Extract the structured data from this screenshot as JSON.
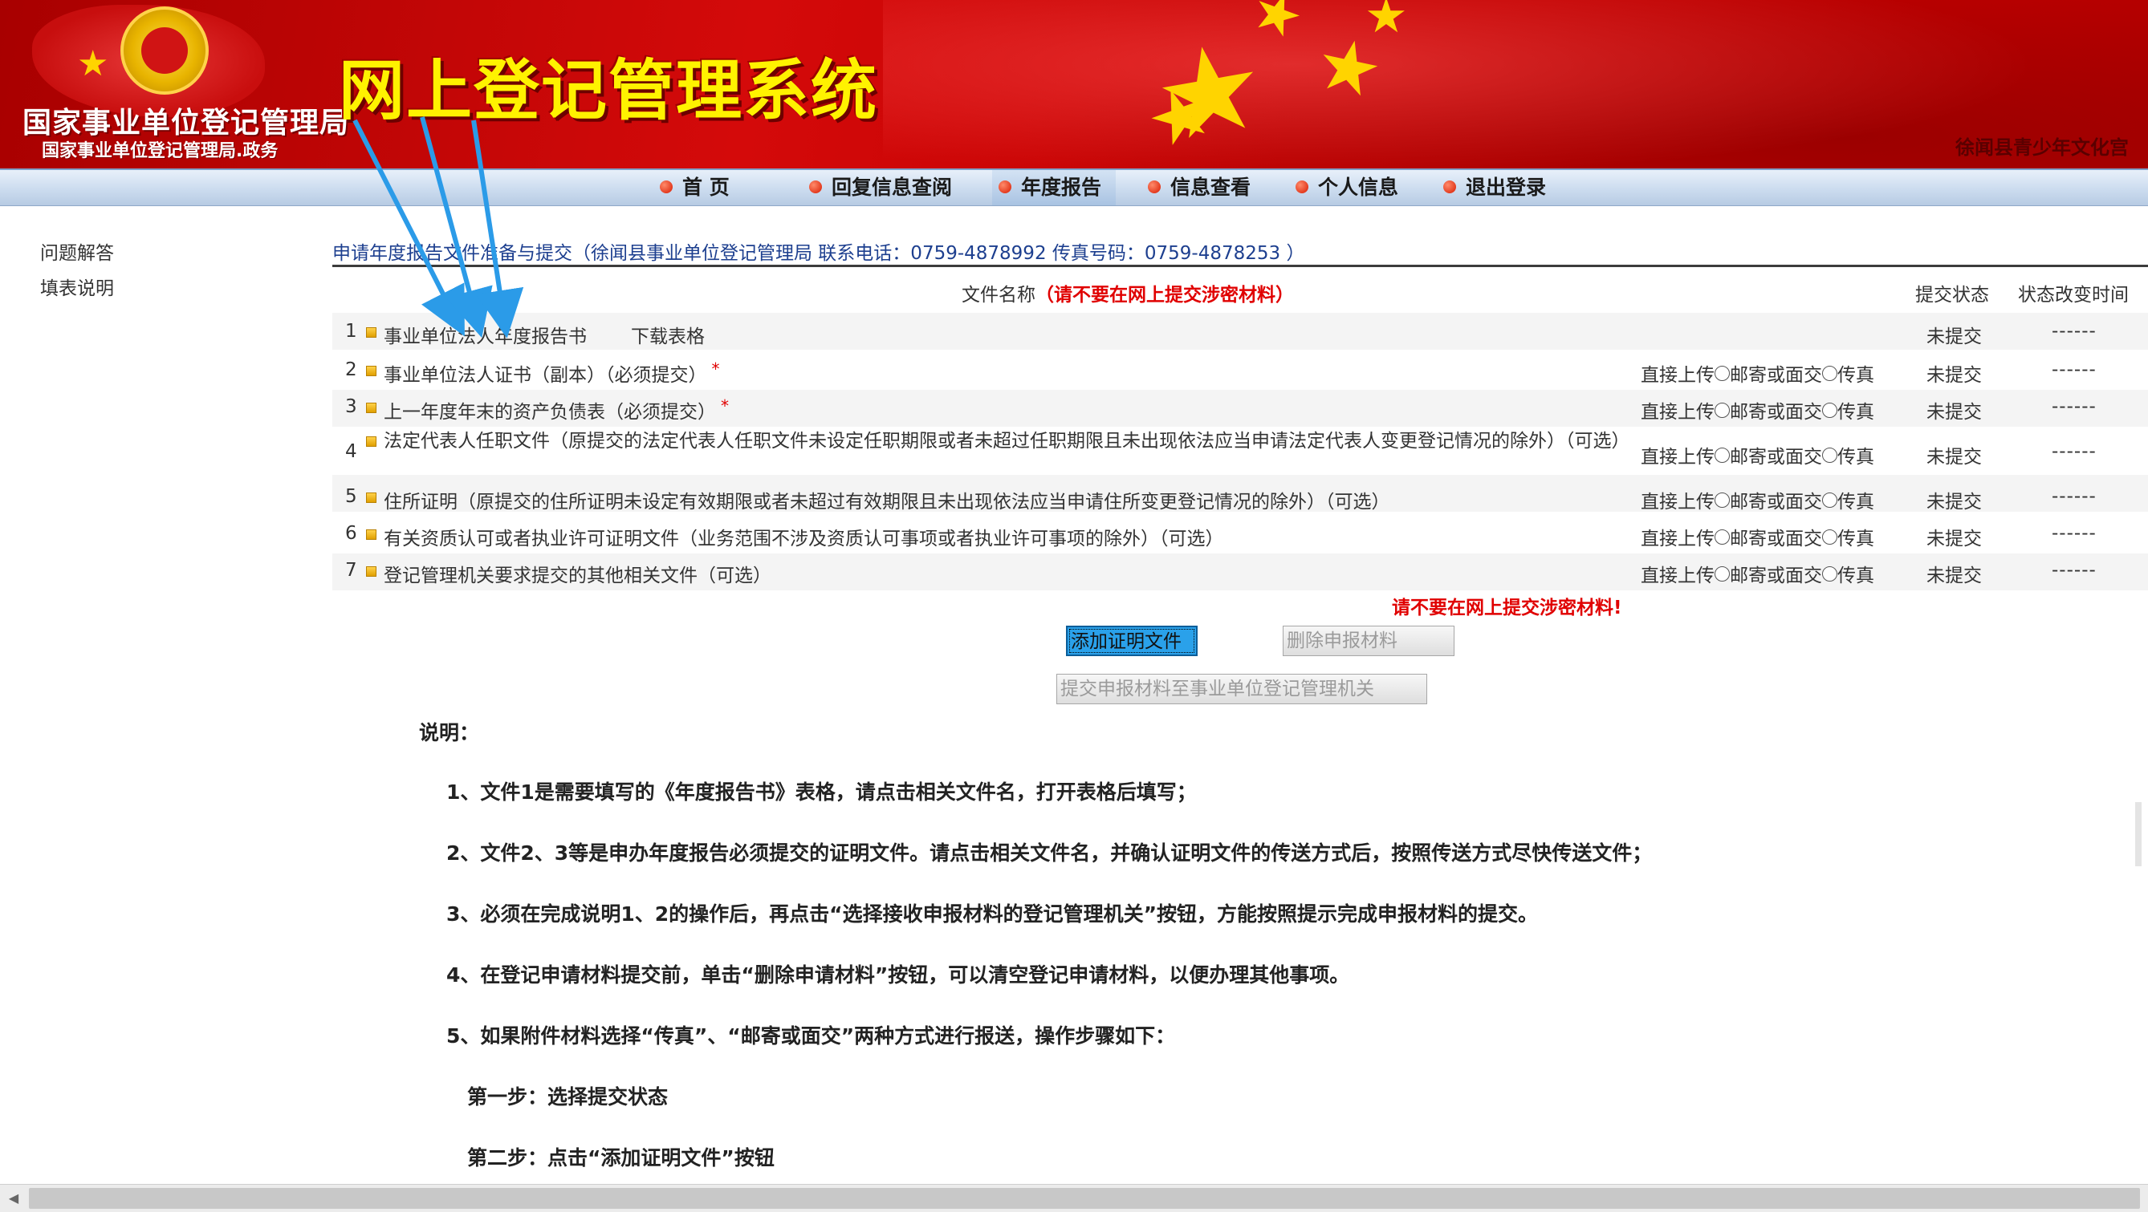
{
  "banner": {
    "org_name": "国家事业单位登记管理局",
    "org_subtitle": "国家事业单位登记管理局.政务",
    "system_title": "网上登记管理系统",
    "unit_name": "徐闻县青少年文化宫"
  },
  "nav": {
    "items": [
      {
        "label": "首  页"
      },
      {
        "label": "回复信息查阅"
      },
      {
        "label": "年度报告"
      },
      {
        "label": "信息查看"
      },
      {
        "label": "个人信息"
      },
      {
        "label": "退出登录"
      }
    ],
    "active": "年度报告"
  },
  "sidebar": {
    "items": [
      {
        "label": "问题解答"
      },
      {
        "label": "填表说明"
      }
    ]
  },
  "main": {
    "header": "申请年度报告文件准备与提交（徐闻县事业单位登记管理局 联系电话：0759-4878992 传真号码：0759-4878253 ）",
    "columns": {
      "file_name": "文件名称",
      "file_name_warning": "（请不要在网上提交涉密材料）",
      "status": "提交状态",
      "change_time": "状态改变时间"
    },
    "rows": [
      {
        "num": "1",
        "name": "事业单位法人年度报告书",
        "download": "下载表格",
        "status": "未提交",
        "time": "------"
      },
      {
        "num": "2",
        "name": "事业单位法人证书（副本）（必须提交）",
        "required_mark": "*",
        "opt_upload": "直接上传",
        "opt_mail": "邮寄或面交",
        "opt_fax": "传真",
        "status": "未提交",
        "time": "------"
      },
      {
        "num": "3",
        "name": "上一年度年末的资产负债表（必须提交）",
        "required_mark": "*",
        "opt_upload": "直接上传",
        "opt_mail": "邮寄或面交",
        "opt_fax": "传真",
        "status": "未提交",
        "time": "------"
      },
      {
        "num": "4",
        "name": "法定代表人任职文件（原提交的法定代表人任职文件未设定任职期限或者未超过任职期限且未出现依法应当申请法定代表人变更登记情况的除外）（可选）",
        "opt_upload": "直接上传",
        "opt_mail": "邮寄或面交",
        "opt_fax": "传真",
        "status": "未提交",
        "time": "------"
      },
      {
        "num": "5",
        "name": "住所证明（原提交的住所证明未设定有效期限或者未超过有效期限且未出现依法应当申请住所变更登记情况的除外）（可选）",
        "opt_upload": "直接上传",
        "opt_mail": "邮寄或面交",
        "opt_fax": "传真",
        "status": "未提交",
        "time": "------"
      },
      {
        "num": "6",
        "name": "有关资质认可或者执业许可证明文件（业务范围不涉及资质认可事项或者执业许可事项的除外）（可选）",
        "opt_upload": "直接上传",
        "opt_mail": "邮寄或面交",
        "opt_fax": "传真",
        "status": "未提交",
        "time": "------"
      },
      {
        "num": "7",
        "name": "登记管理机关要求提交的其他相关文件（可选）",
        "opt_upload": "直接上传",
        "opt_mail": "邮寄或面交",
        "opt_fax": "传真",
        "status": "未提交",
        "time": "------"
      }
    ],
    "warning": "请不要在网上提交涉密材料!",
    "buttons": {
      "add": "添加证明文件",
      "delete": "删除申报材料",
      "submit": "提交申报材料至事业单位登记管理机关"
    }
  },
  "instructions": {
    "title": "说明：",
    "items": [
      "1、文件1是需要填写的《年度报告书》表格，请点击相关文件名，打开表格后填写；",
      "2、文件2、3等是申办年度报告必须提交的证明文件。请点击相关文件名，并确认证明文件的传送方式后，按照传送方式尽快传送文件；",
      "3、必须在完成说明1、2的操作后，再点击“选择接收申报材料的登记管理机关”按钮，方能按照提示完成申报材料的提交。",
      "4、在登记申请材料提交前，单击“删除申请材料”按钮，可以清空登记申请材料，以便办理其他事项。",
      "5、如果附件材料选择“传真”、“邮寄或面交”两种方式进行报送，操作步骤如下："
    ],
    "steps": [
      "第一步：选择提交状态",
      "第二步：点击“添加证明文件”按钮"
    ]
  },
  "colors": {
    "banner_red": "#c20000",
    "title_yellow": "#fff200",
    "link_blue": "#1d3f8f",
    "warning_red": "#e00000",
    "primary_button": "#2aa1ea",
    "annotation_arrow": "#2b9be8"
  },
  "icons": [
    "national-emblem-icon",
    "nav-bullet-icon",
    "file-bullet-icon",
    "radio-icon",
    "scroll-left-icon"
  ]
}
